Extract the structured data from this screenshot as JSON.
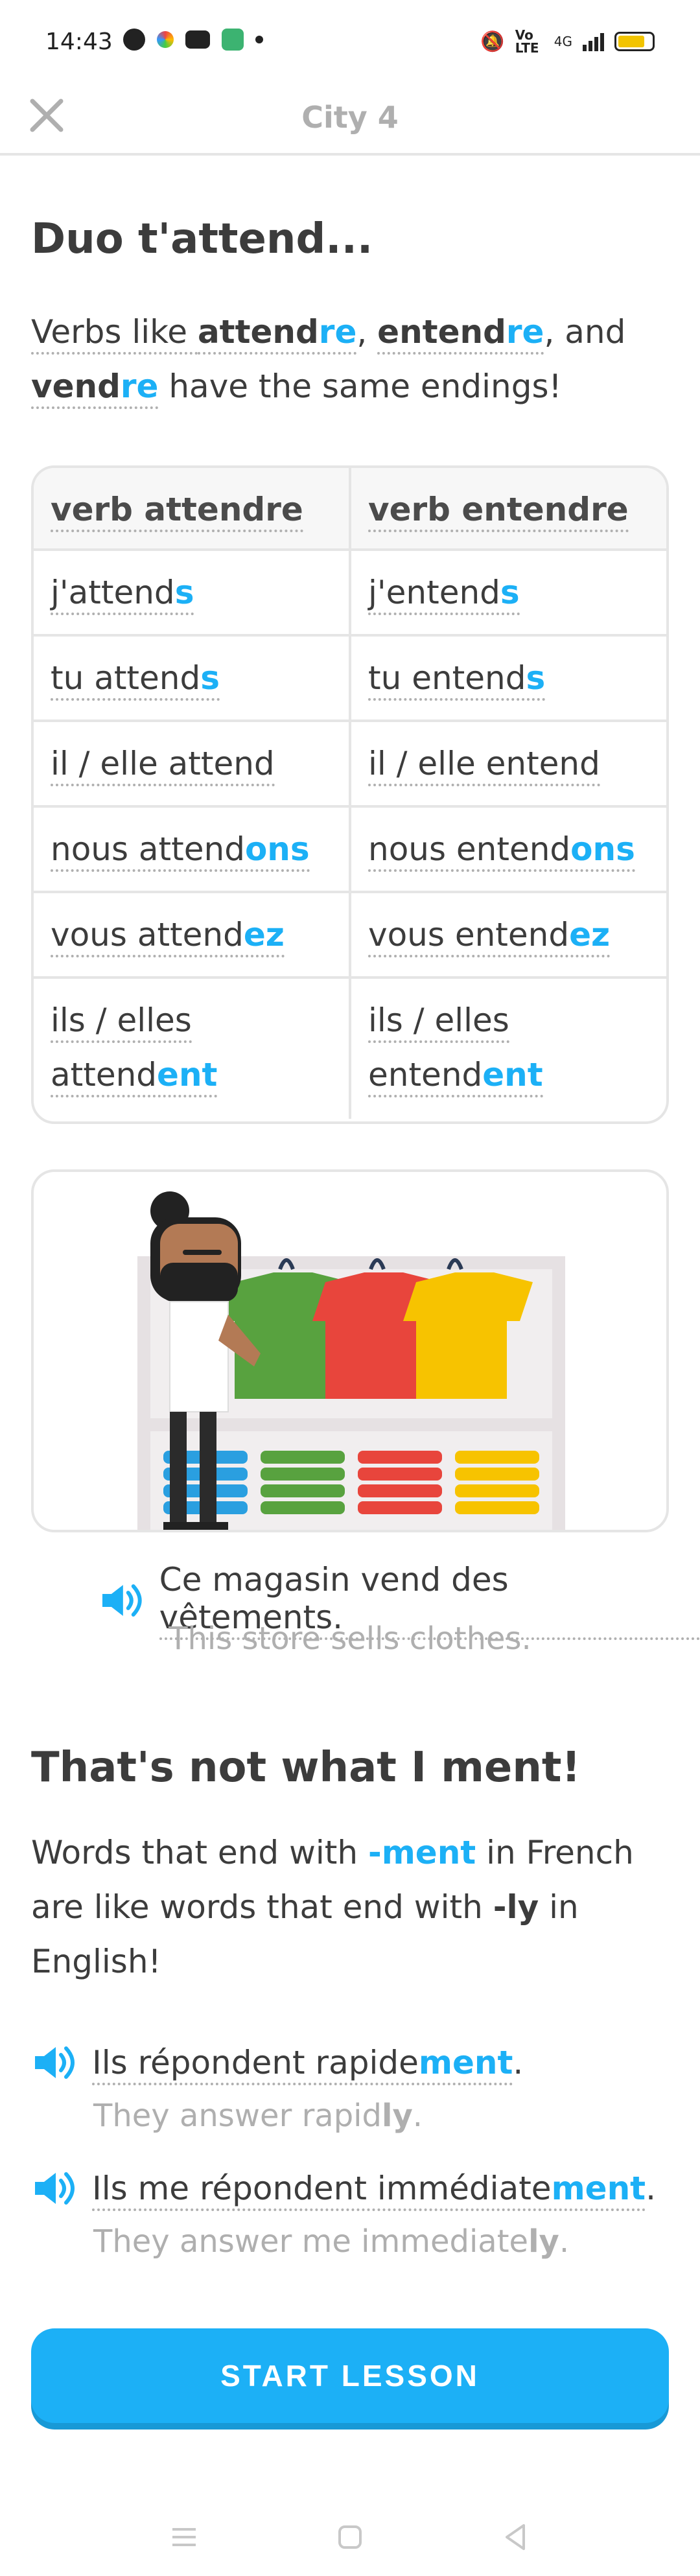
{
  "status": {
    "time": "14:43",
    "network": "Vo LTE",
    "signal": "4G"
  },
  "header": {
    "title": "City 4"
  },
  "section1": {
    "title": "Duo t'attend...",
    "intro": {
      "p1": "Verbs like ",
      "w1a": "attend",
      "w1b": "re",
      "sep1": ", ",
      "w2a": "entend",
      "w2b": "re",
      "sep2": ", and",
      "w3a": "vend",
      "w3b": "re",
      "p2": " have the same endings!"
    }
  },
  "table": {
    "headers": [
      "verb attendre",
      "verb entendre"
    ],
    "rows": [
      [
        {
          "stem": "j'attend",
          "ending": "s"
        },
        {
          "stem": "j'entend",
          "ending": "s"
        }
      ],
      [
        {
          "stem": "tu attend",
          "ending": "s"
        },
        {
          "stem": "tu entend",
          "ending": "s"
        }
      ],
      [
        {
          "stem": "il / elle attend",
          "ending": ""
        },
        {
          "stem": "il / elle entend",
          "ending": ""
        }
      ],
      [
        {
          "stem": "nous attend",
          "ending": "ons"
        },
        {
          "stem": "nous entend",
          "ending": "ons"
        }
      ],
      [
        {
          "stem": "vous attend",
          "ending": "ez"
        },
        {
          "stem": "vous entend",
          "ending": "ez"
        }
      ],
      [
        {
          "stem1": "ils / elles",
          "stem2": "attend",
          "ending": "ent"
        },
        {
          "stem1": "ils / elles",
          "stem2": "entend",
          "ending": "ent"
        }
      ]
    ]
  },
  "example1": {
    "fr": "Ce magasin vend des vêtements.",
    "en": "This store sells clothes."
  },
  "section2": {
    "title": "That's not what I ment!",
    "p1": "Words that end with ",
    "suffix_fr": "-ment",
    "p2": " in French are like words that end with ",
    "suffix_en": "-ly",
    "p3": " in English!"
  },
  "example2": {
    "fr_stem": "Ils répondent rapide",
    "fr_end": "ment",
    "fr_tail": ".",
    "en_stem": "They answer rapid",
    "en_end": "ly",
    "en_tail": "."
  },
  "example3": {
    "fr_stem": "Ils me répondent immédiate",
    "fr_end": "ment",
    "fr_tail": ".",
    "en_stem": "They answer me immediate",
    "en_end": "ly",
    "en_tail": "."
  },
  "button": {
    "label": "START LESSON"
  },
  "colors": {
    "accent": "#1cb0f6",
    "accent_shadow": "#1899d6",
    "text": "#3c3c3c",
    "muted": "#afafaf",
    "border": "#e5e5e5"
  }
}
